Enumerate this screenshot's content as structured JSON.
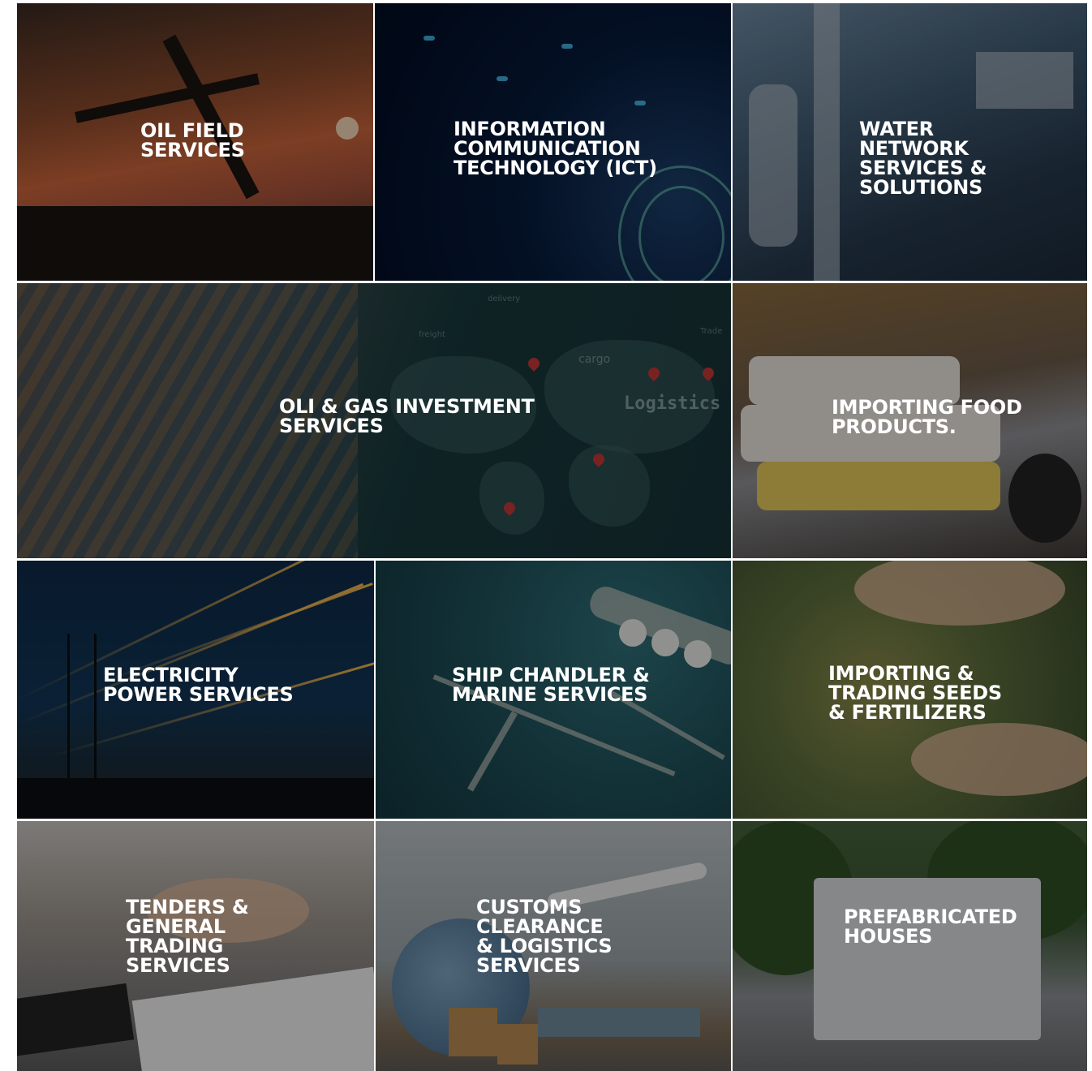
{
  "services": [
    {
      "id": "oil-field",
      "lines": [
        "OIL FIELD",
        "SERVICES"
      ]
    },
    {
      "id": "ict",
      "lines": [
        "INFORMATION",
        "COMMUNICATION",
        "TECHNOLOGY (ICT)"
      ]
    },
    {
      "id": "water",
      "lines": [
        "WATER",
        "NETWORK",
        "SERVICES &",
        "SOLUTIONS"
      ]
    },
    {
      "id": "oli-gas",
      "lines": [
        "OLI & GAS INVESTMENT",
        "SERVICES"
      ]
    },
    {
      "id": "food",
      "lines": [
        "IMPORTING FOOD",
        "PRODUCTS."
      ]
    },
    {
      "id": "electricity",
      "lines": [
        "ELECTRICITY",
        "POWER SERVICES"
      ]
    },
    {
      "id": "ship",
      "lines": [
        "SHIP CHANDLER &",
        "MARINE SERVICES"
      ]
    },
    {
      "id": "seeds",
      "lines": [
        "IMPORTING &",
        "TRADING SEEDS",
        "& FERTILIZERS"
      ]
    },
    {
      "id": "tenders",
      "lines": [
        "TENDERS &",
        "GENERAL",
        "TRADING",
        "SERVICES"
      ]
    },
    {
      "id": "customs",
      "lines": [
        "CUSTOMS",
        "CLEARANCE",
        "& LOGISTICS",
        "SERVICES"
      ]
    },
    {
      "id": "prefab",
      "lines": [
        "PREFABRICATED",
        "HOUSES"
      ]
    }
  ],
  "map_labels": {
    "logistics": "Logistics",
    "cargo": "cargo",
    "delivery": "delivery",
    "freight": "freight",
    "trade": "Trade"
  },
  "colors": {
    "overlay": "#000000",
    "text": "#ffffff",
    "gap": "#ffffff"
  }
}
